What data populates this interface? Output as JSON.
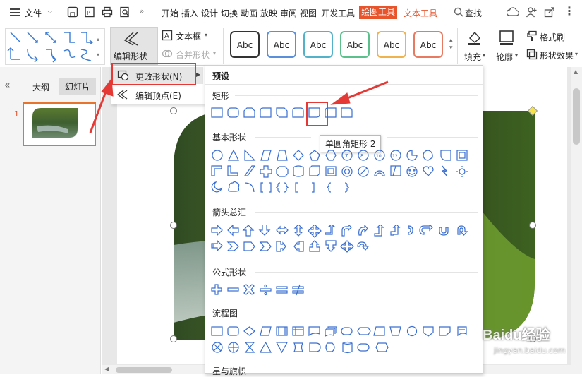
{
  "menubar": {
    "file": "文件",
    "tabs": [
      "开始",
      "插入",
      "设计",
      "切换",
      "动画",
      "放映",
      "审阅",
      "视图",
      "开发工具"
    ],
    "active_tab": "绘图工具",
    "text_tools": "文本工具",
    "search": "查找"
  },
  "ribbon": {
    "edit_shape": "编辑形状",
    "text_box": "文本框",
    "merge_shape": "合并形状",
    "style_label": "Abc",
    "fill": "填充",
    "outline": "轮廓",
    "format_painter": "格式刷",
    "shape_effect": "形状效果"
  },
  "leftpanel": {
    "outline_tab": "大纲",
    "slides_tab": "幻灯片",
    "slide_number": "1"
  },
  "menu": {
    "change_shape": "更改形状(N)",
    "edit_points": "编辑顶点(E)"
  },
  "gallery": {
    "preset": "预设",
    "rect": "矩形",
    "basic": "基本形状",
    "arrows": "箭头总汇",
    "formula": "公式形状",
    "flowchart": "流程图",
    "stars": "星与旗帜"
  },
  "tooltip": "单圆角矩形 2",
  "watermark": {
    "main": "Baidu经验",
    "sub": "jingyan.baidu.com"
  },
  "colors": {
    "accent": "#e8542c",
    "callout": "#e53935"
  }
}
